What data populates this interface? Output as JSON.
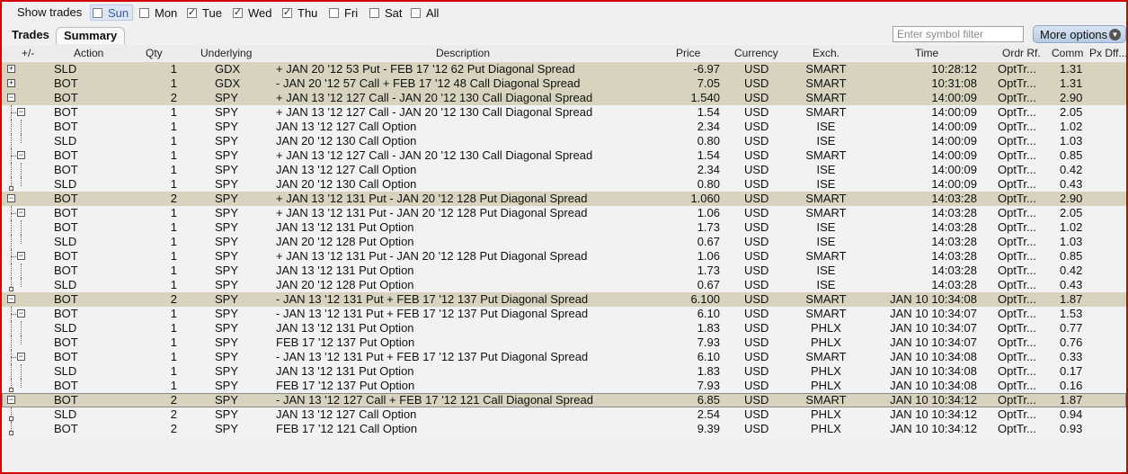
{
  "show_trades": {
    "label": "Show trades",
    "days": [
      {
        "label": "Sun",
        "checked": false,
        "highlight": true
      },
      {
        "label": "Mon",
        "checked": false,
        "highlight": false
      },
      {
        "label": "Tue",
        "checked": true,
        "highlight": false
      },
      {
        "label": "Wed",
        "checked": true,
        "highlight": false
      },
      {
        "label": "Thu",
        "checked": true,
        "highlight": false
      },
      {
        "label": "Fri",
        "checked": false,
        "highlight": false
      },
      {
        "label": "Sat",
        "checked": false,
        "highlight": false
      },
      {
        "label": "All",
        "checked": false,
        "highlight": false
      }
    ]
  },
  "tabs": {
    "trades": "Trades",
    "summary": "Summary"
  },
  "symbol_filter": {
    "placeholder": "Enter symbol filter"
  },
  "more_options": {
    "label": "More options",
    "icon": "chevron-down-icon"
  },
  "columns": [
    "+/-",
    "Action",
    "Qty",
    "Underlying",
    "Description",
    "Price",
    "Currency",
    "Exch.",
    "Time",
    "Ordr Rf.",
    "Comm",
    "Px Dff..."
  ],
  "rows": [
    {
      "tree": "plus",
      "parent": true,
      "action": "SLD",
      "qty": "1",
      "und": "GDX",
      "desc": "+ JAN 20 '12 53 Put - FEB 17 '12 62 Put Diagonal Spread",
      "price": "-6.97",
      "cur": "USD",
      "exch": "SMART",
      "time": "10:28:12",
      "ordr": "OptTr...",
      "comm": "1.31"
    },
    {
      "tree": "plus",
      "parent": true,
      "action": "BOT",
      "qty": "1",
      "und": "GDX",
      "desc": "- JAN 20 '12 57 Call + FEB 17 '12 48 Call Diagonal Spread",
      "price": "7.05",
      "cur": "USD",
      "exch": "SMART",
      "time": "10:31:08",
      "ordr": "OptTr...",
      "comm": "1.31"
    },
    {
      "tree": "minus",
      "parent": true,
      "action": "BOT",
      "qty": "2",
      "und": "SPY",
      "desc": "+ JAN 13 '12 127 Call - JAN 20 '12 130 Call Diagonal Spread",
      "price": "1.540",
      "cur": "USD",
      "exch": "SMART",
      "time": "14:00:09",
      "ordr": "OptTr...",
      "comm": "2.90"
    },
    {
      "tree": "sub",
      "parent": false,
      "action": "BOT",
      "qty": "1",
      "und": "SPY",
      "desc": "+ JAN 13 '12 127 Call - JAN 20 '12 130 Call Diagonal Spread",
      "price": "1.54",
      "cur": "USD",
      "exch": "SMART",
      "time": "14:00:09",
      "ordr": "OptTr...",
      "comm": "2.05"
    },
    {
      "tree": "leaf",
      "parent": false,
      "action": "BOT",
      "qty": "1",
      "und": "SPY",
      "desc": "JAN 13 '12 127 Call Option",
      "price": "2.34",
      "cur": "USD",
      "exch": "ISE",
      "time": "14:00:09",
      "ordr": "OptTr...",
      "comm": "1.02"
    },
    {
      "tree": "leaf",
      "parent": false,
      "action": "SLD",
      "qty": "1",
      "und": "SPY",
      "desc": "JAN 20 '12 130 Call Option",
      "price": "0.80",
      "cur": "USD",
      "exch": "ISE",
      "time": "14:00:09",
      "ordr": "OptTr...",
      "comm": "1.03"
    },
    {
      "tree": "sub",
      "parent": false,
      "action": "BOT",
      "qty": "1",
      "und": "SPY",
      "desc": "+ JAN 13 '12 127 Call - JAN 20 '12 130 Call Diagonal Spread",
      "price": "1.54",
      "cur": "USD",
      "exch": "SMART",
      "time": "14:00:09",
      "ordr": "OptTr...",
      "comm": "0.85"
    },
    {
      "tree": "leaf",
      "parent": false,
      "action": "BOT",
      "qty": "1",
      "und": "SPY",
      "desc": "JAN 13 '12 127 Call Option",
      "price": "2.34",
      "cur": "USD",
      "exch": "ISE",
      "time": "14:00:09",
      "ordr": "OptTr...",
      "comm": "0.42"
    },
    {
      "tree": "leaf",
      "parent": false,
      "action": "SLD",
      "qty": "1",
      "und": "SPY",
      "desc": "JAN 20 '12 130 Call Option",
      "price": "0.80",
      "cur": "USD",
      "exch": "ISE",
      "time": "14:00:09",
      "ordr": "OptTr...",
      "comm": "0.43"
    },
    {
      "tree": "minus",
      "parent": true,
      "action": "BOT",
      "qty": "2",
      "und": "SPY",
      "desc": "+ JAN 13 '12 131 Put - JAN 20 '12 128 Put Diagonal Spread",
      "price": "1.060",
      "cur": "USD",
      "exch": "SMART",
      "time": "14:03:28",
      "ordr": "OptTr...",
      "comm": "2.90"
    },
    {
      "tree": "sub",
      "parent": false,
      "action": "BOT",
      "qty": "1",
      "und": "SPY",
      "desc": "+ JAN 13 '12 131 Put - JAN 20 '12 128 Put Diagonal Spread",
      "price": "1.06",
      "cur": "USD",
      "exch": "SMART",
      "time": "14:03:28",
      "ordr": "OptTr...",
      "comm": "2.05"
    },
    {
      "tree": "leaf",
      "parent": false,
      "action": "BOT",
      "qty": "1",
      "und": "SPY",
      "desc": "JAN 13 '12 131 Put Option",
      "price": "1.73",
      "cur": "USD",
      "exch": "ISE",
      "time": "14:03:28",
      "ordr": "OptTr...",
      "comm": "1.02"
    },
    {
      "tree": "leaf",
      "parent": false,
      "action": "SLD",
      "qty": "1",
      "und": "SPY",
      "desc": "JAN 20 '12 128 Put Option",
      "price": "0.67",
      "cur": "USD",
      "exch": "ISE",
      "time": "14:03:28",
      "ordr": "OptTr...",
      "comm": "1.03"
    },
    {
      "tree": "sub",
      "parent": false,
      "action": "BOT",
      "qty": "1",
      "und": "SPY",
      "desc": "+ JAN 13 '12 131 Put - JAN 20 '12 128 Put Diagonal Spread",
      "price": "1.06",
      "cur": "USD",
      "exch": "SMART",
      "time": "14:03:28",
      "ordr": "OptTr...",
      "comm": "0.85"
    },
    {
      "tree": "leaf",
      "parent": false,
      "action": "BOT",
      "qty": "1",
      "und": "SPY",
      "desc": "JAN 13 '12 131 Put Option",
      "price": "1.73",
      "cur": "USD",
      "exch": "ISE",
      "time": "14:03:28",
      "ordr": "OptTr...",
      "comm": "0.42"
    },
    {
      "tree": "leaf",
      "parent": false,
      "action": "SLD",
      "qty": "1",
      "und": "SPY",
      "desc": "JAN 20 '12 128 Put Option",
      "price": "0.67",
      "cur": "USD",
      "exch": "ISE",
      "time": "14:03:28",
      "ordr": "OptTr...",
      "comm": "0.43"
    },
    {
      "tree": "minus",
      "parent": true,
      "action": "BOT",
      "qty": "2",
      "und": "SPY",
      "desc": "- JAN 13 '12 131 Put + FEB 17 '12 137 Put Diagonal Spread",
      "price": "6.100",
      "cur": "USD",
      "exch": "SMART",
      "time": "JAN 10 10:34:08",
      "ordr": "OptTr...",
      "comm": "1.87"
    },
    {
      "tree": "sub",
      "parent": false,
      "action": "BOT",
      "qty": "1",
      "und": "SPY",
      "desc": "- JAN 13 '12 131 Put + FEB 17 '12 137 Put Diagonal Spread",
      "price": "6.10",
      "cur": "USD",
      "exch": "SMART",
      "time": "JAN 10 10:34:07",
      "ordr": "OptTr...",
      "comm": "1.53"
    },
    {
      "tree": "leaf",
      "parent": false,
      "action": "SLD",
      "qty": "1",
      "und": "SPY",
      "desc": "JAN 13 '12 131 Put Option",
      "price": "1.83",
      "cur": "USD",
      "exch": "PHLX",
      "time": "JAN 10 10:34:07",
      "ordr": "OptTr...",
      "comm": "0.77"
    },
    {
      "tree": "leaf",
      "parent": false,
      "action": "BOT",
      "qty": "1",
      "und": "SPY",
      "desc": "FEB 17 '12 137 Put Option",
      "price": "7.93",
      "cur": "USD",
      "exch": "PHLX",
      "time": "JAN 10 10:34:07",
      "ordr": "OptTr...",
      "comm": "0.76"
    },
    {
      "tree": "sub",
      "parent": false,
      "action": "BOT",
      "qty": "1",
      "und": "SPY",
      "desc": "- JAN 13 '12 131 Put + FEB 17 '12 137 Put Diagonal Spread",
      "price": "6.10",
      "cur": "USD",
      "exch": "SMART",
      "time": "JAN 10 10:34:08",
      "ordr": "OptTr...",
      "comm": "0.33"
    },
    {
      "tree": "leaf",
      "parent": false,
      "action": "SLD",
      "qty": "1",
      "und": "SPY",
      "desc": "JAN 13 '12 131 Put Option",
      "price": "1.83",
      "cur": "USD",
      "exch": "PHLX",
      "time": "JAN 10 10:34:08",
      "ordr": "OptTr...",
      "comm": "0.17"
    },
    {
      "tree": "leaf",
      "parent": false,
      "action": "BOT",
      "qty": "1",
      "und": "SPY",
      "desc": "FEB 17 '12 137 Put Option",
      "price": "7.93",
      "cur": "USD",
      "exch": "PHLX",
      "time": "JAN 10 10:34:08",
      "ordr": "OptTr...",
      "comm": "0.16"
    },
    {
      "tree": "minus",
      "parent": true,
      "selected": true,
      "action": "BOT",
      "qty": "2",
      "und": "SPY",
      "desc": "- JAN 13 '12 127 Call + FEB 17 '12 121 Call Diagonal Spread",
      "price": "6.85",
      "cur": "USD",
      "exch": "SMART",
      "time": "JAN 10 10:34:12",
      "ordr": "OptTr...",
      "comm": "1.87"
    },
    {
      "tree": "leaf2",
      "parent": false,
      "action": "SLD",
      "qty": "2",
      "und": "SPY",
      "desc": "JAN 13 '12 127 Call Option",
      "price": "2.54",
      "cur": "USD",
      "exch": "PHLX",
      "time": "JAN 10 10:34:12",
      "ordr": "OptTr...",
      "comm": "0.94"
    },
    {
      "tree": "leaf2",
      "parent": false,
      "action": "BOT",
      "qty": "2",
      "und": "SPY",
      "desc": "FEB 17 '12 121 Call Option",
      "price": "9.39",
      "cur": "USD",
      "exch": "PHLX",
      "time": "JAN 10 10:34:12",
      "ordr": "OptTr...",
      "comm": "0.93"
    }
  ]
}
